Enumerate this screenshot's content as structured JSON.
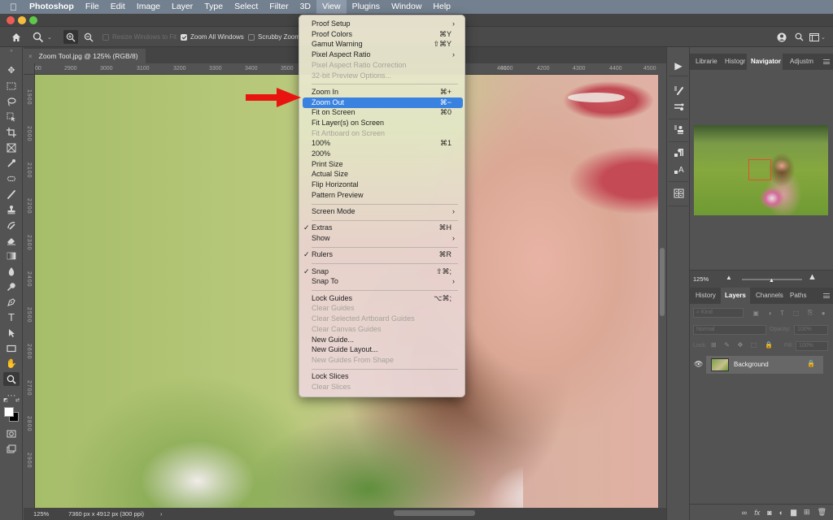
{
  "menubar": {
    "apple": "",
    "items": [
      "Photoshop",
      "File",
      "Edit",
      "Image",
      "Layer",
      "Type",
      "Select",
      "Filter",
      "3D",
      "View",
      "Plugins",
      "Window",
      "Help"
    ],
    "active": "View"
  },
  "options_bar": {
    "resize_windows": "Resize Windows to Fit",
    "zoom_all_windows": "Zoom All Windows",
    "scrubby_zoom": "Scrubby Zoom",
    "zoom_all_checked": true
  },
  "document": {
    "tab_title": "Zoom Tool.jpg @ 125% (RGB/8)",
    "close": "×",
    "hruler": [
      "00",
      "2900",
      "3000",
      "3100",
      "3200",
      "3300",
      "3400",
      "3500",
      "4000",
      "4100",
      "4200",
      "4300",
      "4400",
      "4500"
    ],
    "vruler": [
      "1900",
      "2000",
      "2100",
      "2200",
      "2300",
      "2400",
      "2500",
      "2600",
      "2700",
      "2800",
      "2900"
    ]
  },
  "status": {
    "zoom": "125%",
    "info": "7360 px x 4912 px (300 ppi)",
    "chevron": "›"
  },
  "view_menu": {
    "items": [
      {
        "label": "Proof Setup",
        "submenu": true
      },
      {
        "label": "Proof Colors",
        "shortcut": "⌘Y"
      },
      {
        "label": "Gamut Warning",
        "shortcut": "⇧⌘Y"
      },
      {
        "label": "Pixel Aspect Ratio",
        "submenu": true
      },
      {
        "label": "Pixel Aspect Ratio Correction",
        "disabled": true
      },
      {
        "label": "32-bit Preview Options...",
        "disabled": true
      },
      {
        "separator": true
      },
      {
        "label": "Zoom In",
        "shortcut": "⌘+"
      },
      {
        "label": "Zoom Out",
        "shortcut": "⌘−",
        "highlighted": true
      },
      {
        "label": "Fit on Screen",
        "shortcut": "⌘0"
      },
      {
        "label": "Fit Layer(s) on Screen"
      },
      {
        "label": "Fit Artboard on Screen",
        "disabled": true
      },
      {
        "label": "100%",
        "shortcut": "⌘1"
      },
      {
        "label": "200%"
      },
      {
        "label": "Print Size"
      },
      {
        "label": "Actual Size"
      },
      {
        "label": "Flip Horizontal"
      },
      {
        "label": "Pattern Preview"
      },
      {
        "separator": true
      },
      {
        "label": "Screen Mode",
        "submenu": true
      },
      {
        "separator": true
      },
      {
        "label": "Extras",
        "shortcut": "⌘H",
        "checked": true
      },
      {
        "label": "Show",
        "submenu": true
      },
      {
        "separator": true
      },
      {
        "label": "Rulers",
        "shortcut": "⌘R",
        "checked": true
      },
      {
        "separator": true
      },
      {
        "label": "Snap",
        "shortcut": "⇧⌘;",
        "checked": true
      },
      {
        "label": "Snap To",
        "submenu": true
      },
      {
        "separator": true
      },
      {
        "label": "Lock Guides",
        "shortcut": "⌥⌘;"
      },
      {
        "label": "Clear Guides",
        "disabled": true
      },
      {
        "label": "Clear Selected Artboard Guides",
        "disabled": true
      },
      {
        "label": "Clear Canvas Guides",
        "disabled": true
      },
      {
        "label": "New Guide..."
      },
      {
        "label": "New Guide Layout..."
      },
      {
        "label": "New Guides From Shape",
        "disabled": true
      },
      {
        "separator": true
      },
      {
        "label": "Lock Slices"
      },
      {
        "label": "Clear Slices",
        "disabled": true
      }
    ]
  },
  "navigator_panel": {
    "tabs": [
      "Librarie",
      "Histogr",
      "Navigator",
      "Adjustm"
    ],
    "active_tab": "Navigator",
    "zoom": "125%",
    "zoom_slider_fraction": 0.5
  },
  "layers_panel": {
    "tabs": [
      "History",
      "Layers",
      "Channels",
      "Paths"
    ],
    "active_tab": "Layers",
    "filter_kind": "Kind",
    "blend_mode": "Normal",
    "opacity_label": "Opacity:",
    "opacity_value": "100%",
    "lock_label": "Lock:",
    "fill_label": "Fill:",
    "fill_value": "100%",
    "layers": [
      {
        "name": "Background",
        "visible": true,
        "locked": true
      }
    ]
  },
  "colors": {
    "accent": "#3a82e0",
    "arrow": "#e8140f",
    "nav_box": "#e2502c"
  }
}
